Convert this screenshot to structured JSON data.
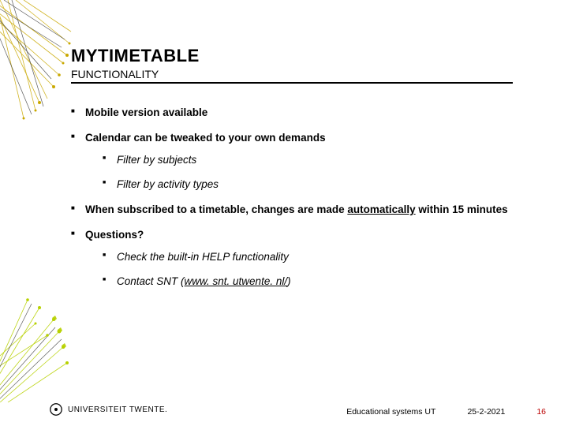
{
  "title": "MYTIMETABLE",
  "subtitle": "FUNCTIONALITY",
  "bullets": {
    "b1": "Mobile version available",
    "b2": "Calendar can be tweaked to your own demands",
    "b2a": "Filter by subjects",
    "b2b": "Filter by activity types",
    "b3_pre": "When subscribed to a timetable, changes are made ",
    "b3_bold": "automatically",
    "b3_post": " within 15 minutes",
    "b4": "Questions?",
    "b4a": "Check the built-in HELP functionality",
    "b4b_pre": "Contact SNT (",
    "b4b_link": "www. snt. utwente. nl/",
    "b4b_post": ")"
  },
  "logo_text": "UNIVERSITEIT TWENTE.",
  "footer": {
    "label": "Educational systems UT",
    "date": "25-2-2021",
    "page": "16"
  }
}
